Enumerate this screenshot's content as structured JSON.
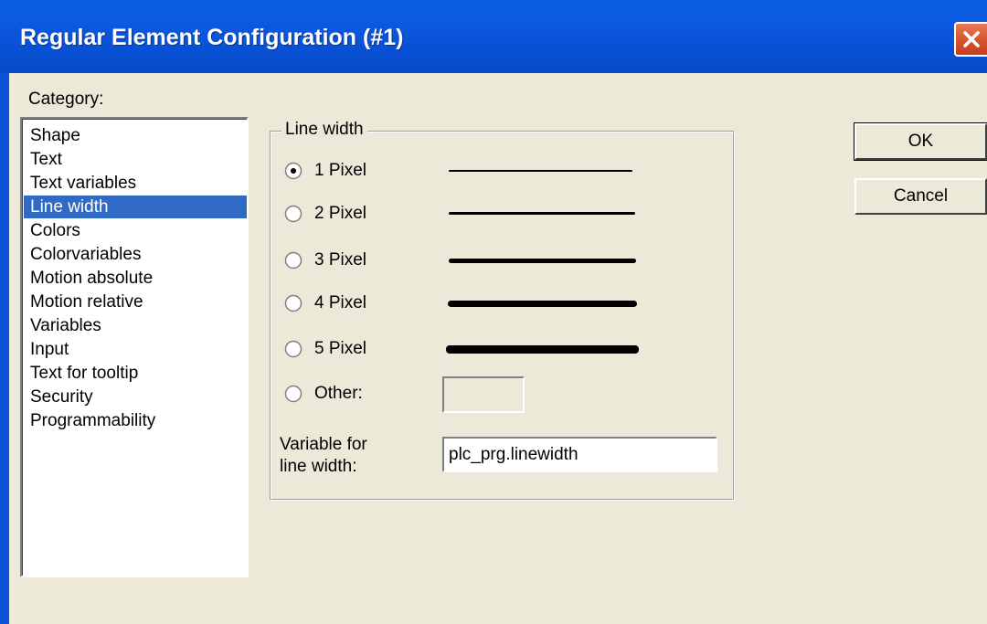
{
  "window": {
    "title": "Regular Element Configuration (#1)"
  },
  "category": {
    "label": "Category:",
    "items": [
      {
        "label": "Shape"
      },
      {
        "label": "Text"
      },
      {
        "label": "Text variables"
      },
      {
        "label": "Line width"
      },
      {
        "label": "Colors"
      },
      {
        "label": "Colorvariables"
      },
      {
        "label": "Motion absolute"
      },
      {
        "label": "Motion relative"
      },
      {
        "label": "Variables"
      },
      {
        "label": "Input"
      },
      {
        "label": "Text for tooltip"
      },
      {
        "label": "Security"
      },
      {
        "label": "Programmability"
      }
    ],
    "selected": "Line width"
  },
  "line_width": {
    "group_label": "Line width",
    "options": [
      {
        "label": "1 Pixel"
      },
      {
        "label": "2 Pixel"
      },
      {
        "label": "3 Pixel"
      },
      {
        "label": "4 Pixel"
      },
      {
        "label": "5 Pixel"
      },
      {
        "label": "Other:"
      }
    ],
    "selected": "1 Pixel",
    "other_value": "",
    "variable_label_line1": "Variable for",
    "variable_label_line2": "line width:",
    "variable_value": "plc_prg.linewidth"
  },
  "buttons": {
    "ok": "OK",
    "cancel": "Cancel"
  },
  "colors": {
    "titlebar": "#0a5fe0",
    "selection": "#316ac5",
    "dialog_bg": "#ece9d8",
    "close_button": "#d85530"
  }
}
